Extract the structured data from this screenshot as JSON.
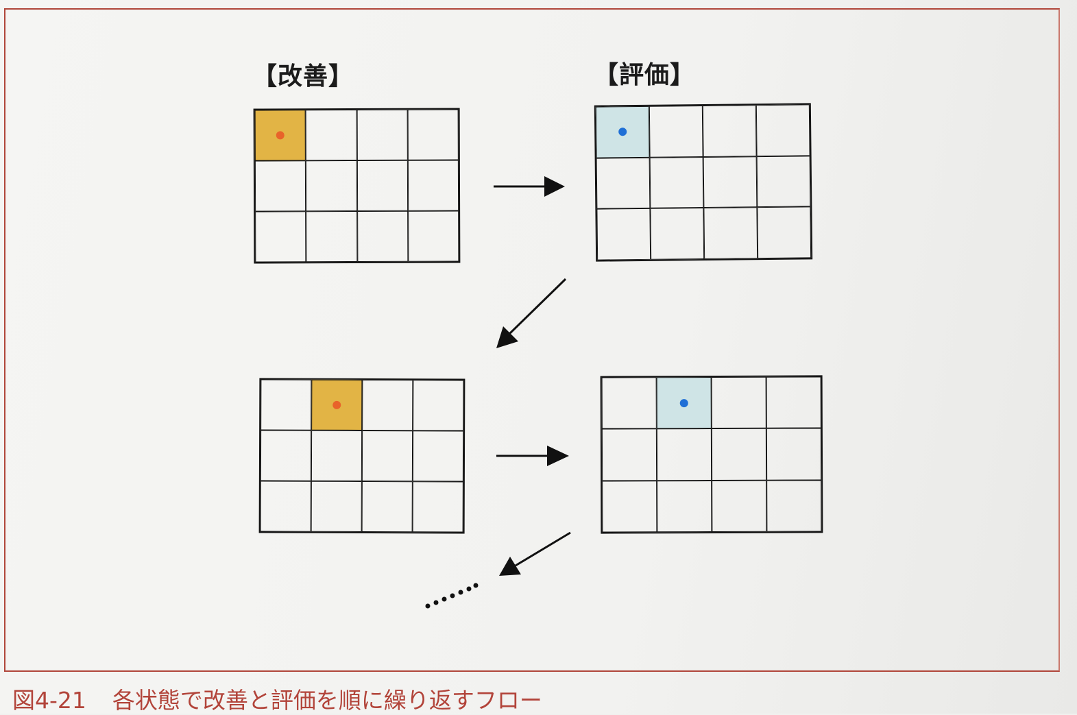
{
  "headings": {
    "improve": "【改善】",
    "evaluate": "【評価】"
  },
  "colors": {
    "improve_fill": "#e2b445",
    "improve_dot": "#e8632a",
    "evaluate_fill": "#cfe4e6",
    "evaluate_dot": "#1f6fd6",
    "frame": "#b0463a",
    "caption": "#b2443a"
  },
  "grids": [
    {
      "id": "top-improve",
      "kind": "improve",
      "rows": 3,
      "cols": 4,
      "highlight": [
        0,
        0
      ]
    },
    {
      "id": "top-evaluate",
      "kind": "evaluate",
      "rows": 3,
      "cols": 4,
      "highlight": [
        0,
        0
      ]
    },
    {
      "id": "bottom-improve",
      "kind": "improve",
      "rows": 3,
      "cols": 4,
      "highlight": [
        0,
        1
      ]
    },
    {
      "id": "bottom-evaluate",
      "kind": "evaluate",
      "rows": 3,
      "cols": 4,
      "highlight": [
        0,
        1
      ]
    }
  ],
  "caption": {
    "number": "図4-21",
    "text": "各状態で改善と評価を順に繰り返すフロー"
  }
}
